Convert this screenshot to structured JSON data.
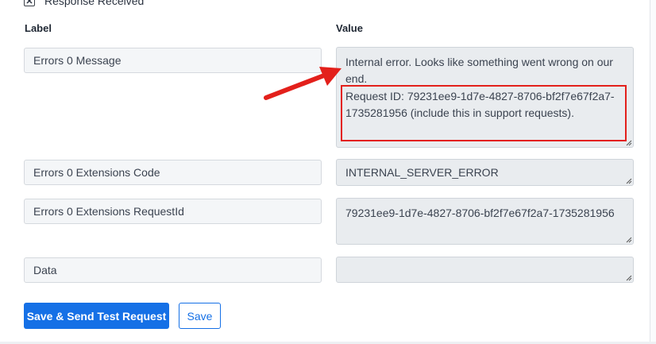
{
  "response_received": {
    "label": "Response Received",
    "checked": true
  },
  "columns": {
    "label": "Label",
    "value": "Value"
  },
  "rows": [
    {
      "label": "Errors 0 Message",
      "value_line1": "Internal error. Looks like something went wrong on our end.",
      "value_line2": "Request ID: 79231ee9-1d7e-4827-8706-bf2f7e67f2a7-1735281956 (include this in support requests)."
    },
    {
      "label": "Errors 0 Extensions Code",
      "value": "INTERNAL_SERVER_ERROR"
    },
    {
      "label": "Errors 0 Extensions RequestId",
      "value": "79231ee9-1d7e-4827-8706-bf2f7e67f2a7-1735281956"
    },
    {
      "label": "Data",
      "value": ""
    }
  ],
  "buttons": {
    "save_send": "Save & Send Test Request",
    "save": "Save"
  },
  "annotations": {
    "arrow_color": "#e3201b",
    "highlight_color": "#e3201b"
  },
  "icons": {
    "checkbox": "checkbox-checked-icon",
    "resize": "resize-grip-icon"
  }
}
